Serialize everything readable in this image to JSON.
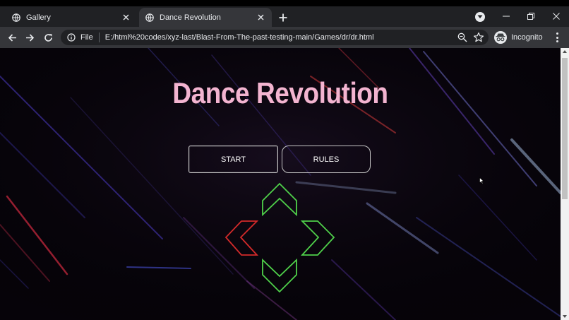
{
  "browser": {
    "tabs": [
      {
        "label": "Gallery",
        "active": false
      },
      {
        "label": "Dance Revolution",
        "active": true
      }
    ],
    "address": {
      "scheme_label": "File",
      "url": "E:/html%20codes/xyz-last/Blast-From-The-past-testing-main/Games/dr/dr.html"
    },
    "profile_label": "Incognito"
  },
  "page": {
    "title": "Dance Revolution",
    "start_label": "START",
    "rules_label": "RULES",
    "arrows": [
      {
        "direction": "up",
        "color": "#4fd04a"
      },
      {
        "direction": "left",
        "color": "#d42a2a"
      },
      {
        "direction": "right",
        "color": "#4fd04a"
      },
      {
        "direction": "down",
        "color": "#4fd04a"
      }
    ]
  },
  "colors": {
    "title": "#f3b4d0",
    "chrome_dark": "#202124",
    "chrome_toolbar": "#35363a"
  }
}
